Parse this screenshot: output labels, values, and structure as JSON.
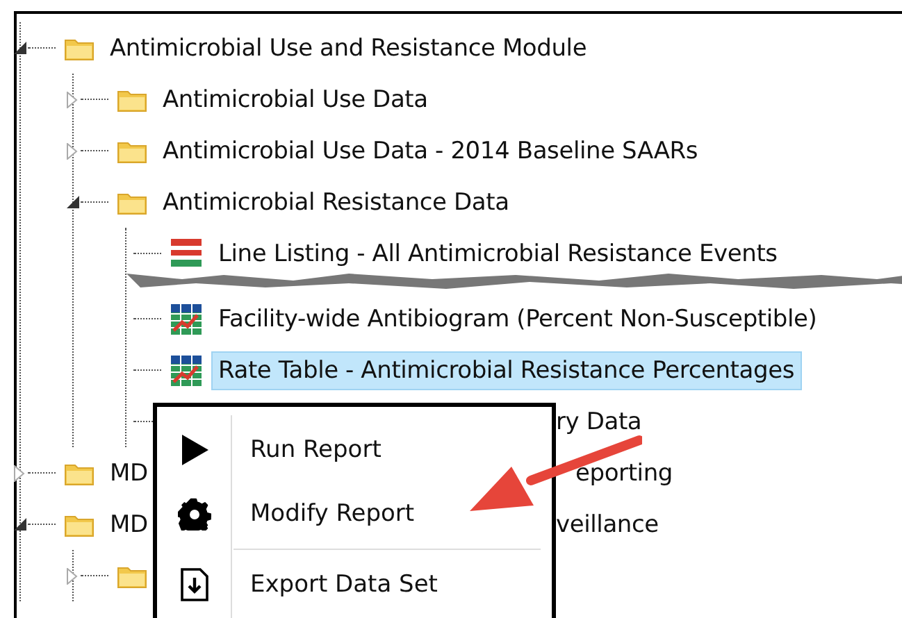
{
  "tree": [
    {
      "label": "Antimicrobial Use and Resistance Module",
      "kind": "folder",
      "expanded": true,
      "selected": false,
      "children": [
        {
          "label": "Antimicrobial Use Data",
          "kind": "folder",
          "expanded": false,
          "selected": false
        },
        {
          "label": "Antimicrobial Use Data - 2014 Baseline SAARs",
          "kind": "folder",
          "expanded": false,
          "selected": false
        },
        {
          "label": "Antimicrobial Resistance Data",
          "kind": "folder",
          "expanded": true,
          "selected": false,
          "children": [
            {
              "label": "Line Listing - All Antimicrobial Resistance Events",
              "kind": "listing",
              "selected": false,
              "torn_below": true
            },
            {
              "label": "Facility-wide Antibiogram (Percent Non-Susceptible)",
              "kind": "report",
              "selected": false
            },
            {
              "label": "Rate Table - Antimicrobial Resistance Percentages",
              "kind": "report",
              "selected": true
            },
            {
              "label_after_menu": "ry Data",
              "selected": false
            }
          ]
        }
      ]
    },
    {
      "label": "MD",
      "label_after_menu": "eporting",
      "kind": "folder",
      "expanded": false,
      "selected": false
    },
    {
      "label": "MD",
      "label_after_menu": "veillance",
      "kind": "folder",
      "expanded": true,
      "selected": false,
      "children": [
        {
          "kind": "folder",
          "expanded": false
        }
      ]
    }
  ],
  "context_menu": {
    "items": [
      {
        "label": "Run Report",
        "kind": "run",
        "divider_above": false
      },
      {
        "label": "Modify Report",
        "kind": "modify",
        "divider_above": false
      },
      {
        "label": "Export Data Set",
        "kind": "export",
        "divider_above": true
      }
    ]
  }
}
